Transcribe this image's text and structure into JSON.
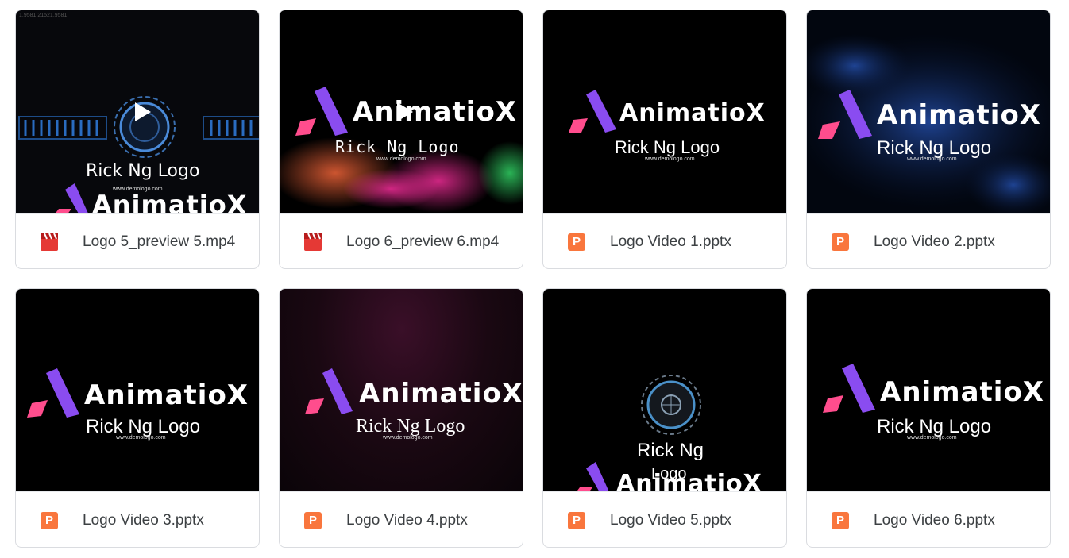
{
  "files": [
    {
      "name": "Logo 5_preview 5.mp4",
      "type": "video"
    },
    {
      "name": "Logo 6_preview 6.mp4",
      "type": "video"
    },
    {
      "name": "Logo Video 1.pptx",
      "type": "pptx"
    },
    {
      "name": "Logo Video 2.pptx",
      "type": "pptx"
    },
    {
      "name": "Logo Video 3.pptx",
      "type": "pptx"
    },
    {
      "name": "Logo Video 4.pptx",
      "type": "pptx"
    },
    {
      "name": "Logo Video 5.pptx",
      "type": "pptx"
    },
    {
      "name": "Logo Video 6.pptx",
      "type": "pptx"
    }
  ],
  "thumb": {
    "brand": "AnimatioX",
    "subtitle": "Rick Ng Logo",
    "subtitle_split_1": "Rick Ng",
    "subtitle_split_2": "Logo",
    "url": "www.demologo.com",
    "timecode": "1.9581 21521.9581"
  },
  "icons": {
    "pptx_letter": "P",
    "video_icon": "clapperboard-icon",
    "play_icon": "play-icon"
  },
  "colors": {
    "pptx": "#f9763d",
    "video": "#e53935",
    "logo_purple": "#8a4cf0",
    "logo_pink": "#ff4d8d"
  }
}
